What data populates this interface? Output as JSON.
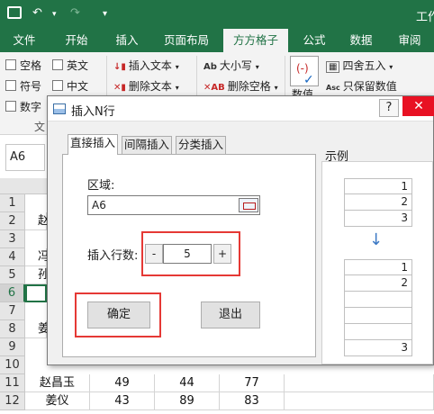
{
  "titlebar": {
    "app_title": "工作",
    "undo_glyph": "↶",
    "redo_glyph": "↷"
  },
  "ribbon_tabs": [
    "文件",
    "开始",
    "插入",
    "页面布局",
    "方方格子",
    "公式",
    "数据",
    "审阅"
  ],
  "ribbon": {
    "checkbox_col1": [
      "空格",
      "符号",
      "数字"
    ],
    "checkbox_col2": [
      "英文",
      "中文"
    ],
    "insert_text": "插入文本",
    "delete_text": "删除文本",
    "case": "大小写",
    "delete_space": "删除空格",
    "numeric": "数值",
    "round": "四舍五入",
    "keep_value": "只保留数值",
    "group_label": "文"
  },
  "namebox": "A6",
  "sheet": {
    "rows": [
      "1",
      "2",
      "3",
      "4",
      "5",
      "6",
      "7",
      "8",
      "9",
      "10",
      "11",
      "12"
    ],
    "row11": [
      "赵昌玉",
      "49",
      "44",
      "77"
    ],
    "row12": [
      "姜仪",
      "43",
      "89",
      "83"
    ],
    "peek": [
      "赵",
      "冯",
      "孙",
      "姜"
    ]
  },
  "dialog": {
    "title": "插入N行",
    "help": "?",
    "close": "✕",
    "tabs": [
      "直接插入",
      "间隔插入",
      "分类插入"
    ],
    "area_label": "区域:",
    "area_value": "A6",
    "rows_label": "插入行数:",
    "minus": "-",
    "plus": "+",
    "rows_value": "5",
    "ok": "确定",
    "exit": "退出",
    "example_label": "示例",
    "example_before": [
      "1",
      "2",
      "3"
    ],
    "example_after": [
      "1",
      "2",
      "",
      "",
      "",
      "3"
    ],
    "arrow": "↓"
  },
  "colors": {
    "excel_green": "#217346",
    "highlight": "#e53935",
    "close_red": "#e81123"
  }
}
